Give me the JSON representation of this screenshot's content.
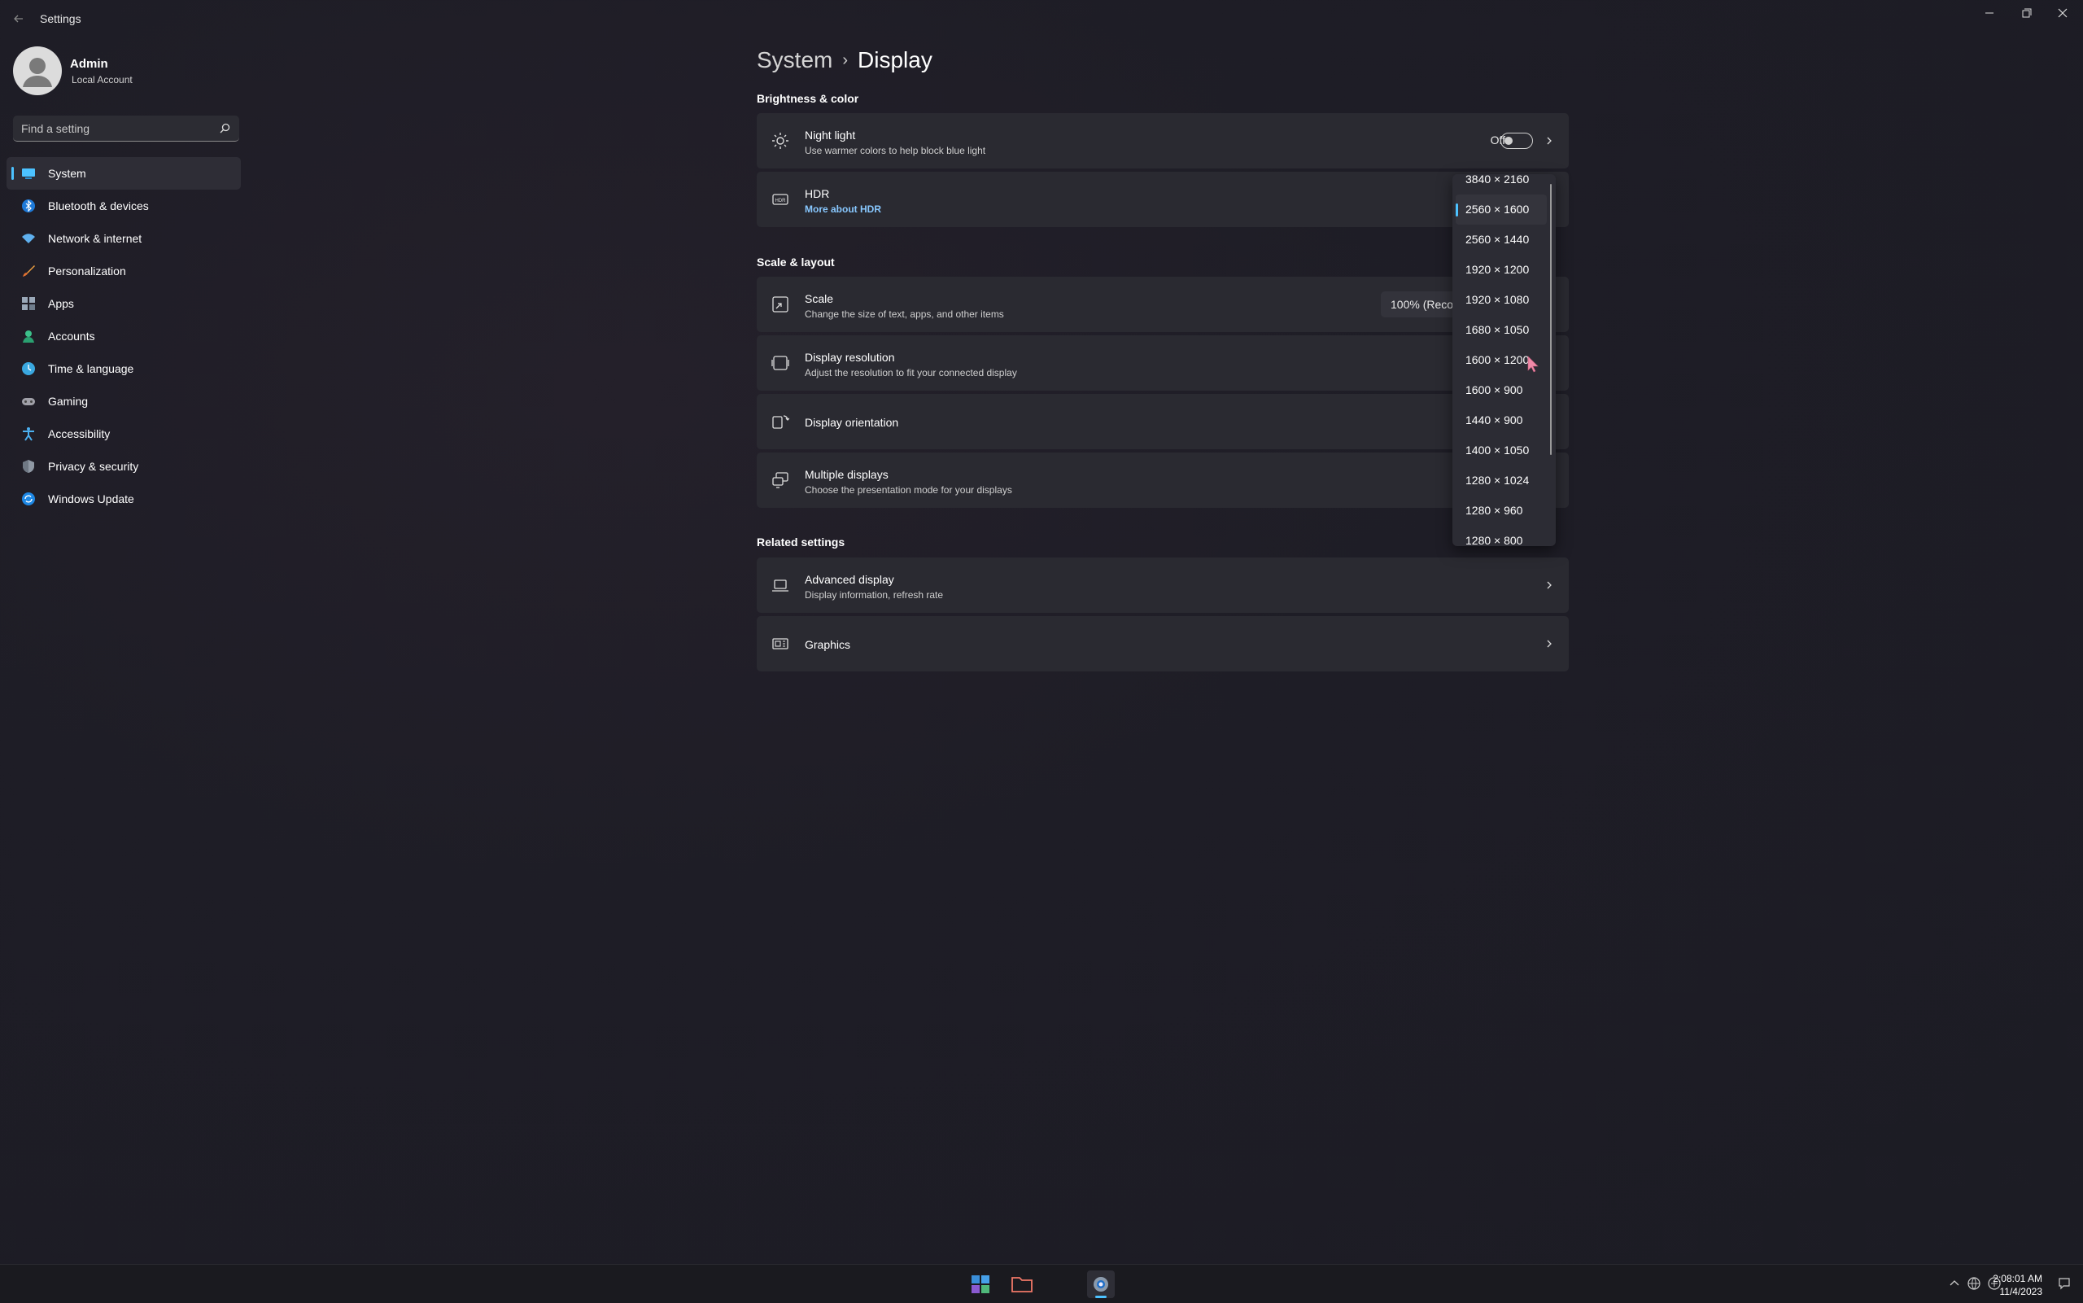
{
  "window": {
    "title": "Settings"
  },
  "user": {
    "name": "Admin",
    "account_type": "Local Account"
  },
  "search": {
    "placeholder": "Find a setting"
  },
  "sidebar": {
    "items": [
      {
        "label": "System",
        "icon": "system-icon",
        "active": true
      },
      {
        "label": "Bluetooth & devices",
        "icon": "bluetooth-icon"
      },
      {
        "label": "Network & internet",
        "icon": "wifi-icon"
      },
      {
        "label": "Personalization",
        "icon": "brush-icon"
      },
      {
        "label": "Apps",
        "icon": "apps-icon"
      },
      {
        "label": "Accounts",
        "icon": "accounts-icon"
      },
      {
        "label": "Time & language",
        "icon": "time-language-icon"
      },
      {
        "label": "Gaming",
        "icon": "gaming-icon"
      },
      {
        "label": "Accessibility",
        "icon": "accessibility-icon"
      },
      {
        "label": "Privacy & security",
        "icon": "shield-icon"
      },
      {
        "label": "Windows Update",
        "icon": "update-icon"
      }
    ]
  },
  "breadcrumb": {
    "parent": "System",
    "separator": "›",
    "current": "Display"
  },
  "sections": {
    "brightness": "Brightness & color",
    "scale_layout": "Scale & layout",
    "related": "Related settings"
  },
  "cards": {
    "night_light": {
      "title": "Night light",
      "subtitle": "Use warmer colors to help block blue light",
      "toggle_state": "Off"
    },
    "hdr": {
      "title": "HDR",
      "link": "More about HDR"
    },
    "scale": {
      "title": "Scale",
      "subtitle": "Change the size of text, apps, and other items",
      "value": "100% (Recommended)"
    },
    "resolution": {
      "title": "Display resolution",
      "subtitle": "Adjust the resolution to fit your connected display"
    },
    "orientation": {
      "title": "Display orientation"
    },
    "multiple": {
      "title": "Multiple displays",
      "subtitle": "Choose the presentation mode for your displays"
    },
    "advanced": {
      "title": "Advanced display",
      "subtitle": "Display information, refresh rate"
    },
    "graphics": {
      "title": "Graphics"
    }
  },
  "resolution_dropdown": {
    "selected": "2560 × 1600",
    "options": [
      "3840 × 2160",
      "2560 × 1600",
      "2560 × 1440",
      "1920 × 1200",
      "1920 × 1080",
      "1680 × 1050",
      "1600 × 1200",
      "1600 × 900",
      "1440 × 900",
      "1400 × 1050",
      "1280 × 1024",
      "1280 × 960",
      "1280 × 800"
    ]
  },
  "taskbar": {
    "apps": [
      "start-icon",
      "file-explorer-icon",
      "settings-icon"
    ],
    "time": "2:08:01 AM",
    "date": "11/4/2023"
  },
  "colors": {
    "accent": "#4cc2ff",
    "card": "#2a2a31",
    "link": "#88c8ff"
  }
}
